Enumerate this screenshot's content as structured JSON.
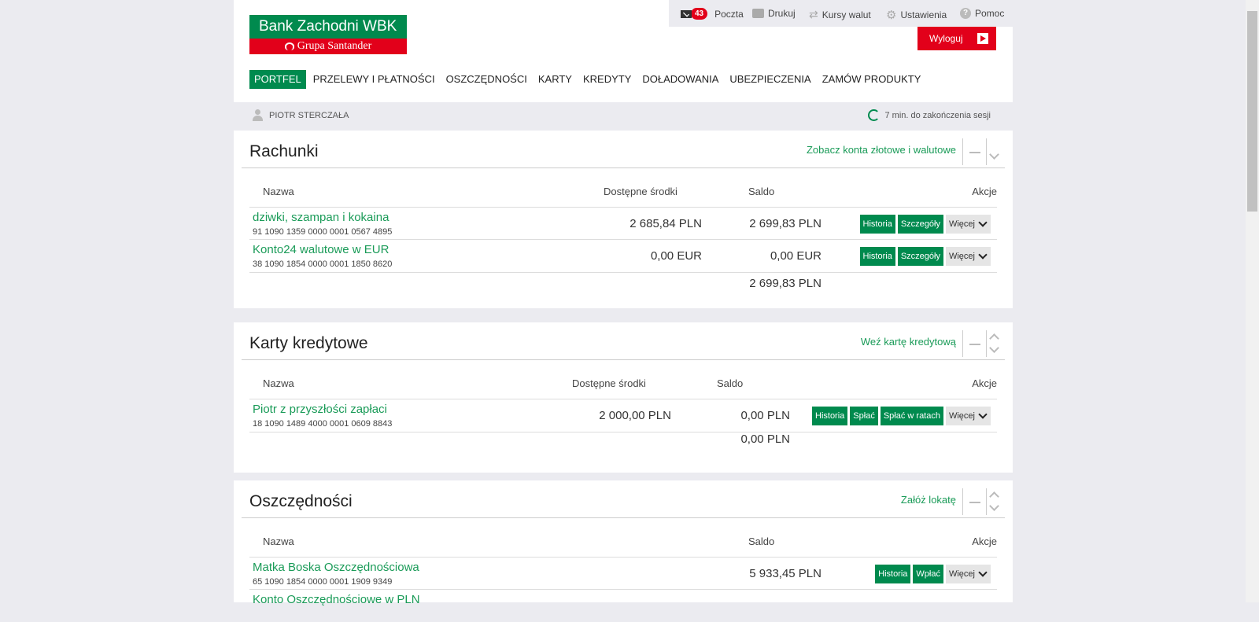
{
  "logo": {
    "bank_name": "Bank Zachodni WBK",
    "group_name": "Grupa Santander"
  },
  "colors": {
    "brand_green": "#008a4e",
    "brand_red": "#e2001a",
    "link_green": "#1a9b58"
  },
  "utility": {
    "mail": {
      "icon": "envelope-icon",
      "count": "43",
      "label": "Poczta"
    },
    "print": {
      "icon": "printer-icon",
      "label": "Drukuj"
    },
    "fx": {
      "icon": "exchange-icon",
      "label": "Kursy walut"
    },
    "settings": {
      "icon": "gear-icon",
      "label": "Ustawienia"
    },
    "help": {
      "icon": "question-icon",
      "label": "Pomoc"
    },
    "logout": {
      "label": "Wyloguj",
      "icon": "exit-icon"
    }
  },
  "nav": [
    "PORTFEL",
    "PRZELEWY I PŁATNOŚCI",
    "OSZCZĘDNOŚCI",
    "KARTY",
    "KREDYTY",
    "DOŁADOWANIA",
    "UBEZPIECZENIA",
    "ZAMÓW PRODUKTY"
  ],
  "user": {
    "name": "PIOTR STERCZAŁA",
    "session": "7 min. do zakończenia sesji"
  },
  "accounts": {
    "title": "Rachunki",
    "link": "Zobacz konta złotowe i walutowe",
    "headers": {
      "name": "Nazwa",
      "available": "Dostępne środki",
      "balance": "Saldo",
      "actions": "Akcje"
    },
    "rows": [
      {
        "name": "dziwki, szampan i kokaina",
        "number": "91 1090 1359 0000 0001 0567 4895",
        "available": "2 685,84 PLN",
        "balance": "2 699,83 PLN",
        "btn1": "Historia",
        "btn2": "Szczegóły",
        "more": "Więcej"
      },
      {
        "name": "Konto24 walutowe w EUR",
        "number": "38 1090 1854 0000 0001 1850 8620",
        "available": "0,00 EUR",
        "balance": "0,00 EUR",
        "btn1": "Historia",
        "btn2": "Szczegóły",
        "more": "Więcej"
      }
    ],
    "total": "2 699,83 PLN"
  },
  "cards": {
    "title": "Karty kredytowe",
    "link": "Weź kartę kredytową",
    "headers": {
      "name": "Nazwa",
      "available": "Dostępne środki",
      "balance": "Saldo",
      "actions": "Akcje"
    },
    "rows": [
      {
        "name": "Piotr z przyszłości zapłaci",
        "number": "18 1090 1489 4000 0001 0609 8843",
        "available": "2 000,00 PLN",
        "balance": "0,00 PLN",
        "btn1": "Historia",
        "btn2": "Spłać",
        "btn3": "Spłać w ratach",
        "more": "Więcej"
      }
    ],
    "total": "0,00 PLN"
  },
  "savings": {
    "title": "Oszczędności",
    "link": "Załóż lokatę",
    "headers": {
      "name": "Nazwa",
      "balance": "Saldo",
      "actions": "Akcje"
    },
    "rows": [
      {
        "name": "Matka Boska Oszczędnościowa",
        "number": "65 1090 1854 0000 0001 1909 9349",
        "balance": "5 933,45 PLN",
        "btn1": "Historia",
        "btn2": "Wpłać",
        "more": "Więcej"
      },
      {
        "name": "Konto Oszczędnościowe w PLN"
      }
    ]
  }
}
